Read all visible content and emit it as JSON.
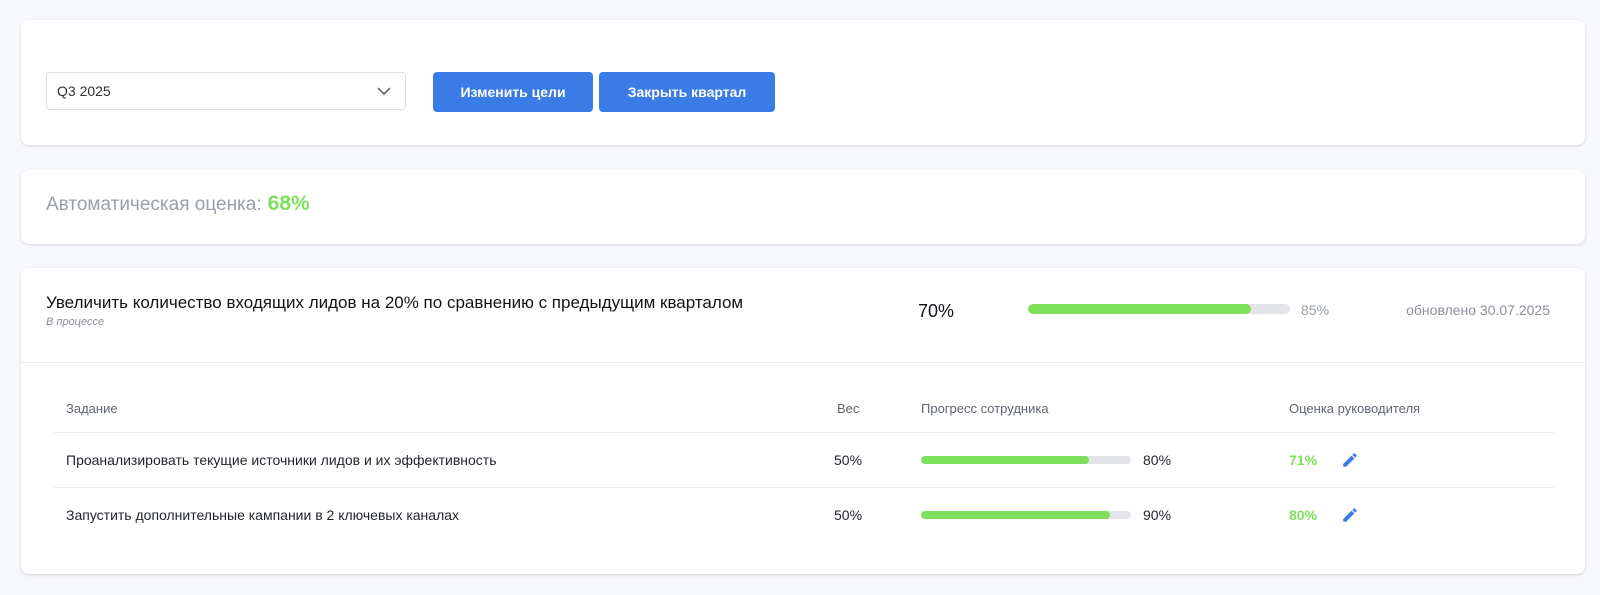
{
  "toolbar": {
    "quarter_select": {
      "value": "Q3 2025",
      "icon": "chevron-down-icon"
    },
    "edit_goals_label": "Изменить цели",
    "close_quarter_label": "Закрыть квартал"
  },
  "auto_score": {
    "label": "Автоматическая оценка:",
    "value": "68%"
  },
  "goal": {
    "title": "Увеличить количество входящих лидов на 20% по сравнению с предыдущим кварталом",
    "status": "В процессе",
    "percent": "70%",
    "progress_fraction": 0.85,
    "target": "85%",
    "updated": "обновлено 30.07.2025"
  },
  "tasks": {
    "columns": {
      "task": "Задание",
      "weight": "Вес",
      "progress": "Прогресс сотрудника",
      "review": "Оценка руководителя"
    },
    "rows": [
      {
        "name": "Проанализировать текущие источники лидов и их эффективность",
        "weight": "50%",
        "progress_fraction": 0.8,
        "progress": "80%",
        "review": "71%"
      },
      {
        "name": "Запустить дополнительные кампании в 2 ключевых каналах",
        "weight": "50%",
        "progress_fraction": 0.9,
        "progress": "90%",
        "review": "80%"
      }
    ]
  },
  "colors": {
    "primary": "#3a7be5",
    "success": "#7de05a",
    "track": "#e2e4e8",
    "muted": "#9aa0aa"
  }
}
